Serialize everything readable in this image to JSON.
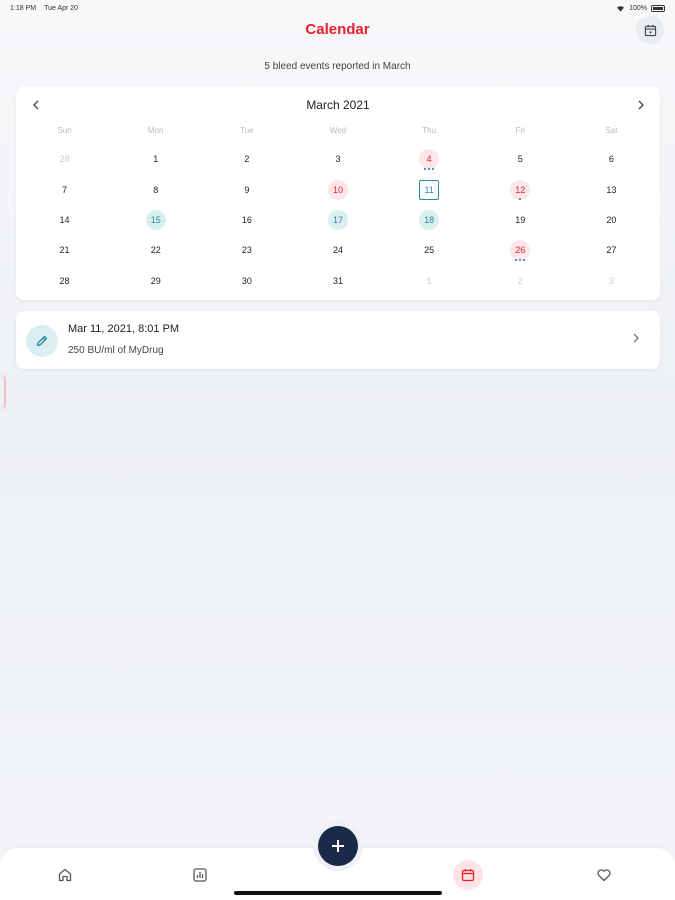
{
  "status_bar": {
    "time": "1:18 PM",
    "date": "Tue Apr 20",
    "battery": "100%"
  },
  "header": {
    "title": "Calendar",
    "calendar_button_icon": "calendar-icon"
  },
  "summary": "5 bleed events reported in March",
  "calendar": {
    "month_label": "March 2021",
    "weekdays": [
      "Sun",
      "Mon",
      "Tue",
      "Wed",
      "Thu",
      "Fri",
      "Sat"
    ],
    "weeks": [
      [
        {
          "d": "28",
          "other": true
        },
        {
          "d": "1"
        },
        {
          "d": "2"
        },
        {
          "d": "3"
        },
        {
          "d": "4",
          "mark": "bleed",
          "dots": [
            "blue",
            "blue",
            "blue"
          ]
        },
        {
          "d": "5"
        },
        {
          "d": "6"
        }
      ],
      [
        {
          "d": "7"
        },
        {
          "d": "8"
        },
        {
          "d": "9"
        },
        {
          "d": "10",
          "mark": "bleed"
        },
        {
          "d": "11",
          "mark": "today"
        },
        {
          "d": "12",
          "mark": "bleed",
          "dots": [
            "blue"
          ]
        },
        {
          "d": "13"
        }
      ],
      [
        {
          "d": "14"
        },
        {
          "d": "15",
          "mark": "treat"
        },
        {
          "d": "16"
        },
        {
          "d": "17",
          "mark": "treat"
        },
        {
          "d": "18",
          "mark": "treat"
        },
        {
          "d": "19"
        },
        {
          "d": "20"
        }
      ],
      [
        {
          "d": "21"
        },
        {
          "d": "22"
        },
        {
          "d": "23"
        },
        {
          "d": "24"
        },
        {
          "d": "25"
        },
        {
          "d": "26",
          "mark": "bleed",
          "dots": [
            "blue",
            "blue",
            "blue"
          ]
        },
        {
          "d": "27"
        }
      ],
      [
        {
          "d": "28"
        },
        {
          "d": "29"
        },
        {
          "d": "30"
        },
        {
          "d": "31"
        },
        {
          "d": "1",
          "other": true
        },
        {
          "d": "2",
          "other": true
        },
        {
          "d": "3",
          "other": true
        }
      ]
    ]
  },
  "event": {
    "title": "Mar 11, 2021, 8:01 PM",
    "subtitle": "250 BU/ml of MyDrug",
    "icon": "pencil-icon"
  },
  "nav": {
    "tabs": [
      "home-icon",
      "stats-icon",
      "calendar-icon",
      "heart-icon"
    ],
    "active": "calendar-icon",
    "fab_icon": "plus-icon"
  },
  "colors": {
    "accent_red": "#e8202e",
    "teal": "#2a8aa0",
    "navy": "#1b2a48",
    "bleed_bg": "#fce6e8",
    "treat_bg": "#dbeef2"
  }
}
